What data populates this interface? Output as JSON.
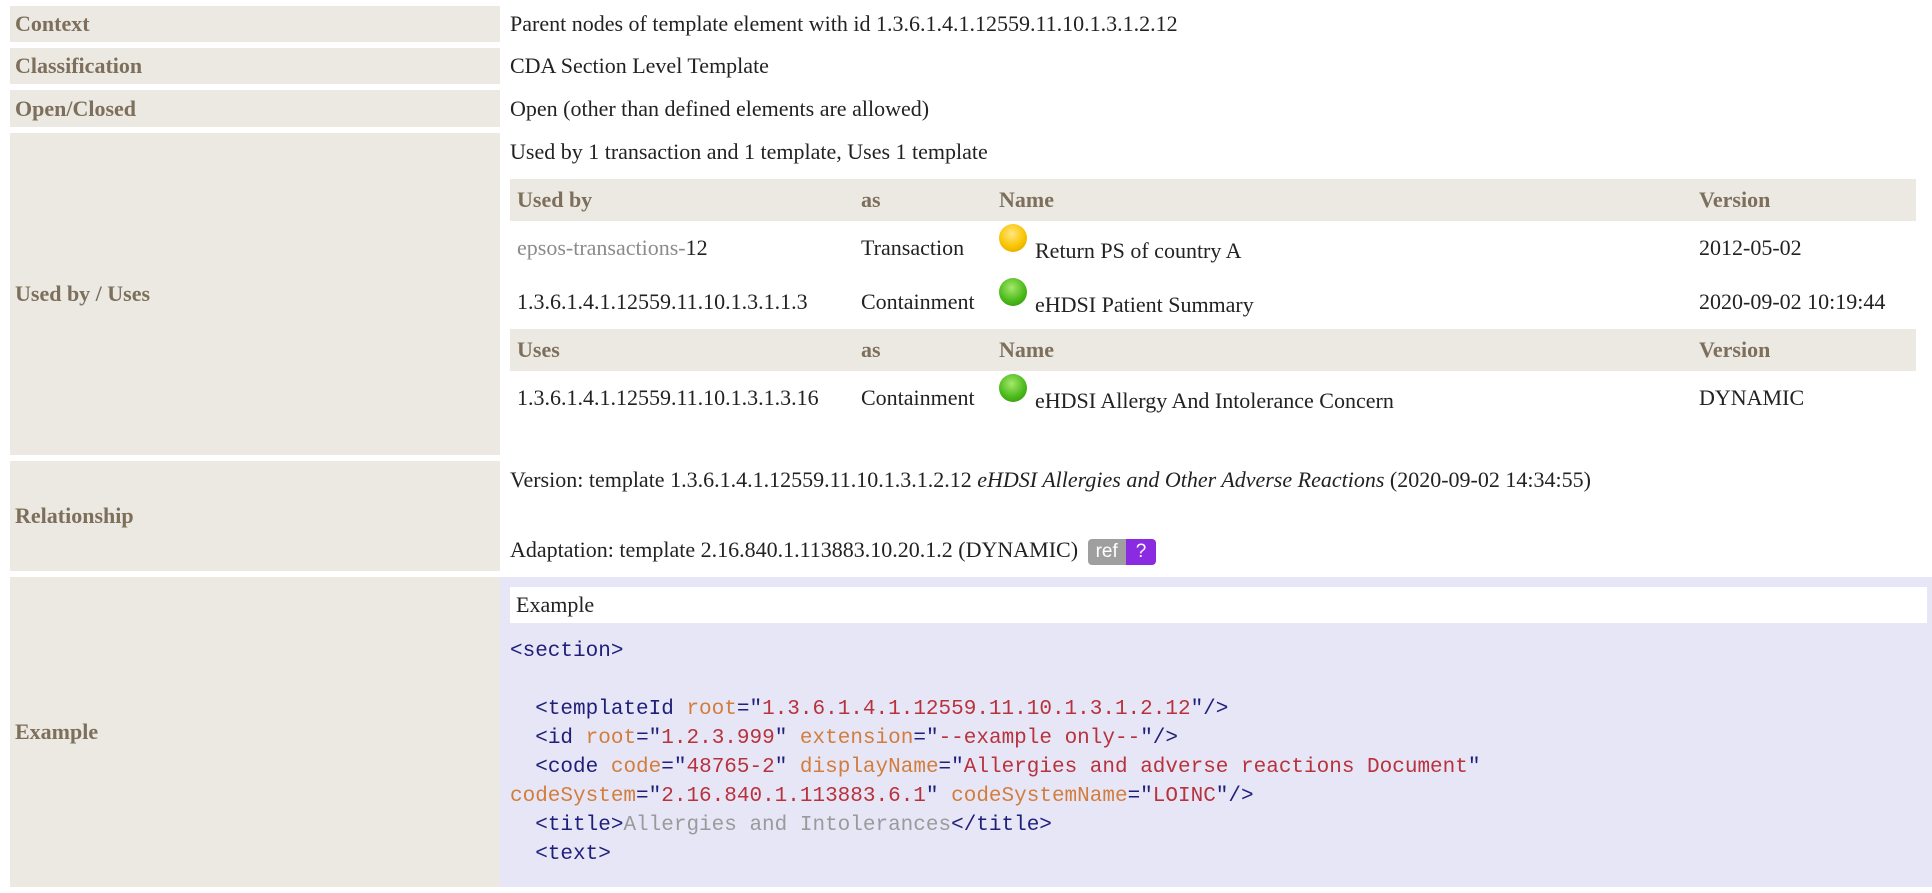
{
  "rows": {
    "context": {
      "label": "Context",
      "value": "Parent nodes of template element with id 1.3.6.1.4.1.12559.11.10.1.3.1.2.12"
    },
    "classification": {
      "label": "Classification",
      "value": "CDA Section Level Template"
    },
    "open_closed": {
      "label": "Open/Closed",
      "value": "Open (other than defined elements are allowed)"
    },
    "used_by": {
      "label": "Used by / Uses",
      "summary": "Used by 1 transaction and 1 template, Uses 1 template",
      "used_by_headers": [
        "Used by",
        "as",
        "Name",
        "Version"
      ],
      "used_by_rows": [
        {
          "id_prefix": "epsos-transactions-",
          "id_suffix": "12",
          "as": "Transaction",
          "status": "yellow",
          "name": "Return PS of country A",
          "version": "2012-05-02"
        },
        {
          "id_prefix": "",
          "id_suffix": "1.3.6.1.4.1.12559.11.10.1.3.1.1.3",
          "as": "Containment",
          "status": "green",
          "name": "eHDSI Patient Summary",
          "version": "2020-09-02 10:19:44"
        }
      ],
      "uses_headers": [
        "Uses",
        "as",
        "Name",
        "Version"
      ],
      "uses_rows": [
        {
          "id": "1.3.6.1.4.1.12559.11.10.1.3.1.3.16",
          "as": "Containment",
          "status": "green",
          "name": "eHDSI Allergy And Intolerance Concern",
          "version": "DYNAMIC"
        }
      ]
    },
    "relationship": {
      "label": "Relationship",
      "version_prefix": "Version: template 1.3.6.1.4.1.12559.11.10.1.3.1.2.12 ",
      "version_name": "eHDSI Allergies and Other Adverse Reactions",
      "version_suffix": " (2020-09-02 14:34:55)",
      "adaptation": "Adaptation: template 2.16.840.1.113883.10.20.1.2 (DYNAMIC)",
      "ref_badge": "ref",
      "help_badge": "?"
    },
    "example": {
      "label": "Example",
      "header": "Example",
      "code": {
        "section_open": "<section>",
        "templateId_root": "1.3.6.1.4.1.12559.11.10.1.3.1.2.12",
        "id_root": "1.2.3.999",
        "id_extension": "--example only--",
        "code_code": "48765-2",
        "code_displayName": "Allergies and adverse reactions Document",
        "code_codeSystem": "2.16.840.1.113883.6.1",
        "code_codeSystemName": "LOINC",
        "title_text": "Allergies and Intolerances"
      }
    }
  },
  "colors": {
    "label_bg": "#ece9e3",
    "label_text": "#7d6f5b",
    "example_bg": "#e7e6f7",
    "badge_purple": "#8a2be2"
  }
}
